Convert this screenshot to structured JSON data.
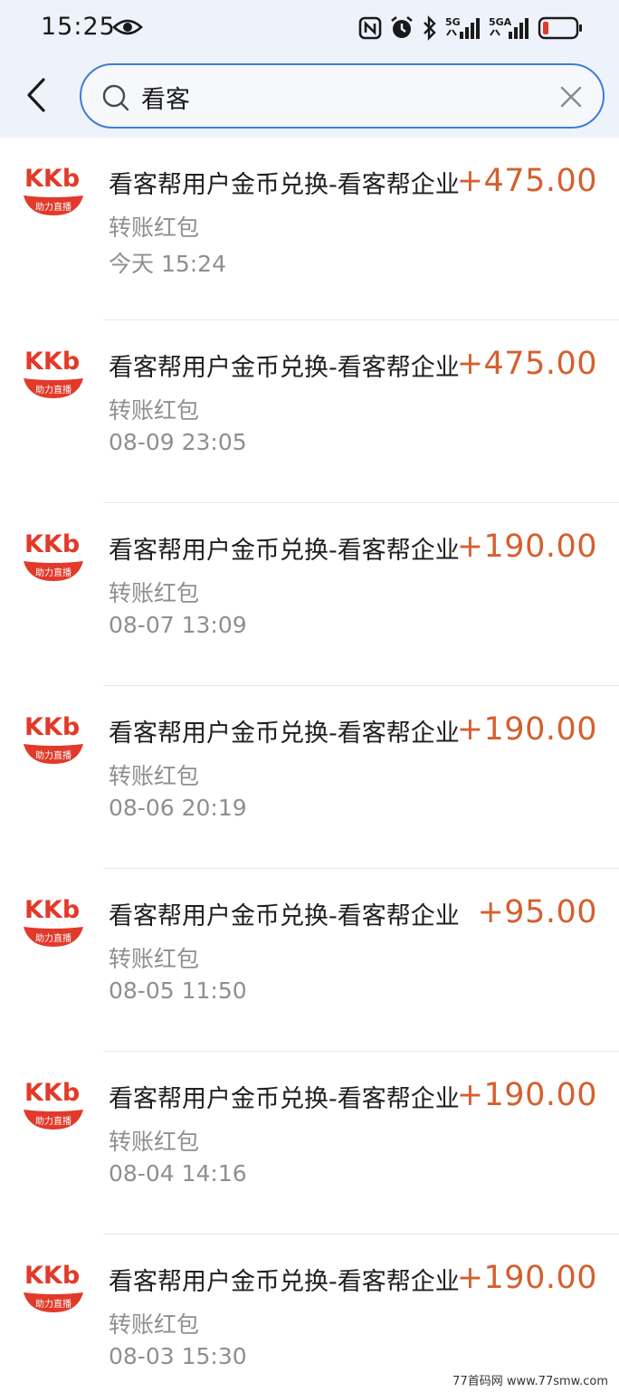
{
  "status_bar": {
    "time": "15:25",
    "net1": "5G",
    "net2": "5GA",
    "icons": [
      "eye-icon",
      "nfc-icon",
      "alarm-icon",
      "bluetooth-icon",
      "signal-icon",
      "battery-icon"
    ]
  },
  "search": {
    "value": "看客"
  },
  "logo": {
    "brand_text": "KKb",
    "tagline": "助力直播",
    "brand_color": "#e23a2a"
  },
  "accent_color": "#3d7cd9",
  "amount_color": "#d4602e",
  "items": [
    {
      "title": "看客帮用户金币兑换-看客帮企业",
      "subtitle": "转账红包",
      "time": "今天 15:24",
      "amount": "+475.00"
    },
    {
      "title": "看客帮用户金币兑换-看客帮企业",
      "subtitle": "转账红包",
      "time": "08-09 23:05",
      "amount": "+475.00"
    },
    {
      "title": "看客帮用户金币兑换-看客帮企业",
      "subtitle": "转账红包",
      "time": "08-07 13:09",
      "amount": "+190.00"
    },
    {
      "title": "看客帮用户金币兑换-看客帮企业",
      "subtitle": "转账红包",
      "time": "08-06 20:19",
      "amount": "+190.00"
    },
    {
      "title": "看客帮用户金币兑换-看客帮企业",
      "subtitle": "转账红包",
      "time": "08-05 11:50",
      "amount": "+95.00"
    },
    {
      "title": "看客帮用户金币兑换-看客帮企业",
      "subtitle": "转账红包",
      "time": "08-04 14:16",
      "amount": "+190.00"
    },
    {
      "title": "看客帮用户金币兑换-看客帮企业",
      "subtitle": "转账红包",
      "time": "08-03 15:30",
      "amount": "+190.00"
    }
  ],
  "watermark": "77首码网 www.77smw.com"
}
